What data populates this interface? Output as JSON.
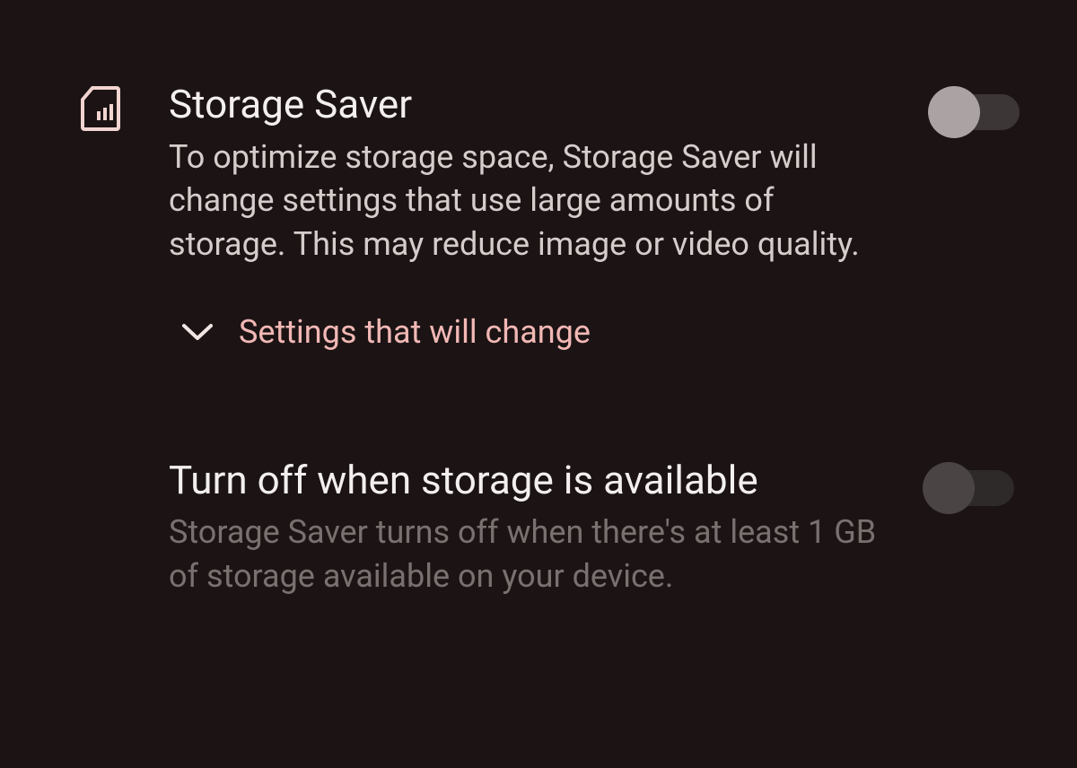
{
  "storage_saver": {
    "title": "Storage Saver",
    "description": "To optimize storage space, Storage Saver will change settings that use large amounts of storage. This may reduce image or video quality.",
    "expand_label": "Settings that will change",
    "toggle_on": false
  },
  "auto_off": {
    "title": "Turn off when storage is available",
    "description": "Storage Saver turns off when there's at least 1 GB of storage available on your device.",
    "toggle_on": false,
    "disabled": true
  }
}
